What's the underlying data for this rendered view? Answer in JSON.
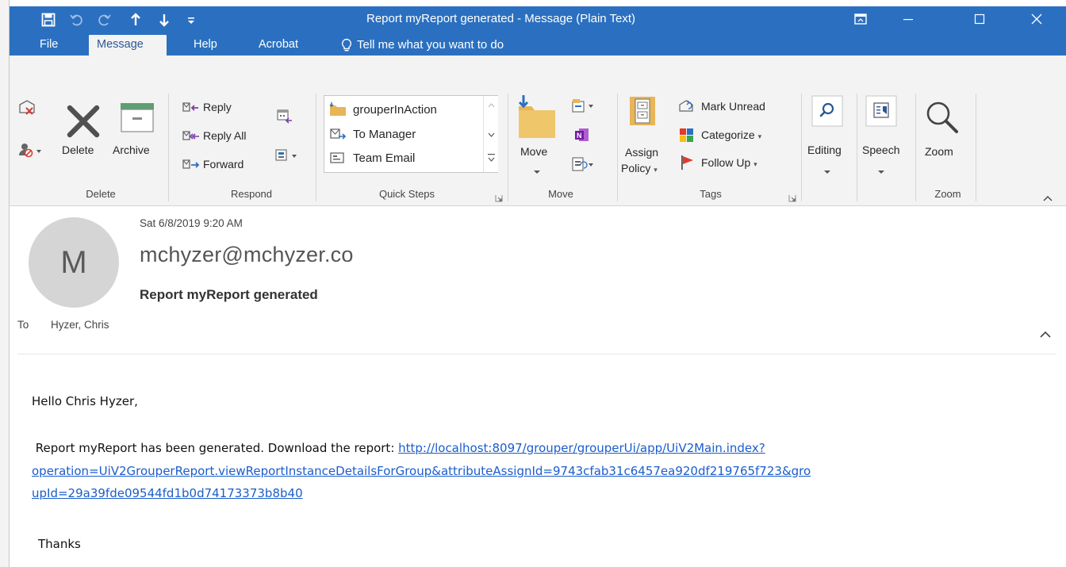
{
  "window": {
    "title": "Report myReport generated  -  Message (Plain Text)"
  },
  "tabs": [
    {
      "label": "File",
      "active": false
    },
    {
      "label": "Message",
      "active": true
    },
    {
      "label": "Help",
      "active": false
    },
    {
      "label": "Acrobat",
      "active": false
    }
  ],
  "tell_me": "Tell me what you want to do",
  "ribbon": {
    "delete_group": {
      "label": "Delete",
      "delete": "Delete",
      "archive": "Archive"
    },
    "respond_group": {
      "label": "Respond",
      "reply": "Reply",
      "reply_all": "Reply All",
      "forward": "Forward"
    },
    "quick_steps": {
      "label": "Quick Steps",
      "items": [
        "grouperInAction",
        "To Manager",
        "Team Email"
      ]
    },
    "move_group": {
      "label": "Move",
      "move": "Move"
    },
    "tags_group": {
      "label": "Tags",
      "assign": "Assign",
      "policy": "Policy",
      "mark_unread": "Mark Unread",
      "categorize": "Categorize",
      "follow_up": "Follow Up"
    },
    "editing": "Editing",
    "speech": "Speech",
    "zoom_group": {
      "label": "Zoom",
      "zoom": "Zoom"
    }
  },
  "message": {
    "avatar_initial": "M",
    "date": "Sat 6/8/2019 9:20 AM",
    "from": "mchyzer@mchyzer.co",
    "subject": "Report myReport generated",
    "to_label": "To",
    "to": "Hyzer, Chris",
    "body": {
      "greeting": "Hello Chris Hyzer,",
      "line_prefix": " Report myReport has been generated. Download the report: ",
      "link_line1": "http://localhost:8097/grouper/grouperUi/app/UiV2Main.index?",
      "link_line2": "operation=UiV2GrouperReport.viewReportInstanceDetailsForGroup&attributeAssignId=9743cfab31c6457ea920df219765f723&gro",
      "link_line3": "upId=29a39fde09544fd1b0d74173373b8b40",
      "thanks": "Thanks"
    }
  },
  "colors": {
    "title_bar": "#2b70c0",
    "ribbon_bg": "#f3f3f3",
    "link": "#1b5dcc"
  }
}
